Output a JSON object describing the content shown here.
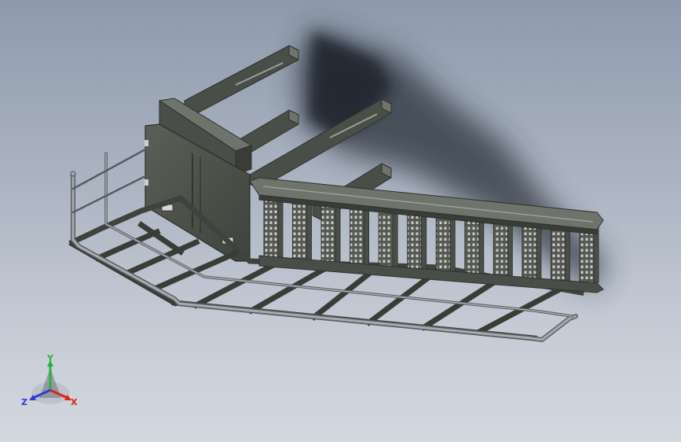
{
  "viewport": {
    "background_top": "#8e9aab",
    "background_bottom": "#d3d8df"
  },
  "model": {
    "steel_color": "#4a4e48",
    "steel_light": "#6e736b",
    "rail_color": "#8f9296",
    "shadow_color": "#2b313b",
    "tread_count": 12
  },
  "triad": {
    "x_label": "X",
    "y_label": "Y",
    "z_label": "Z",
    "x_color": "#e0201a",
    "y_color": "#1fb43a",
    "z_color": "#2a3fd8"
  }
}
